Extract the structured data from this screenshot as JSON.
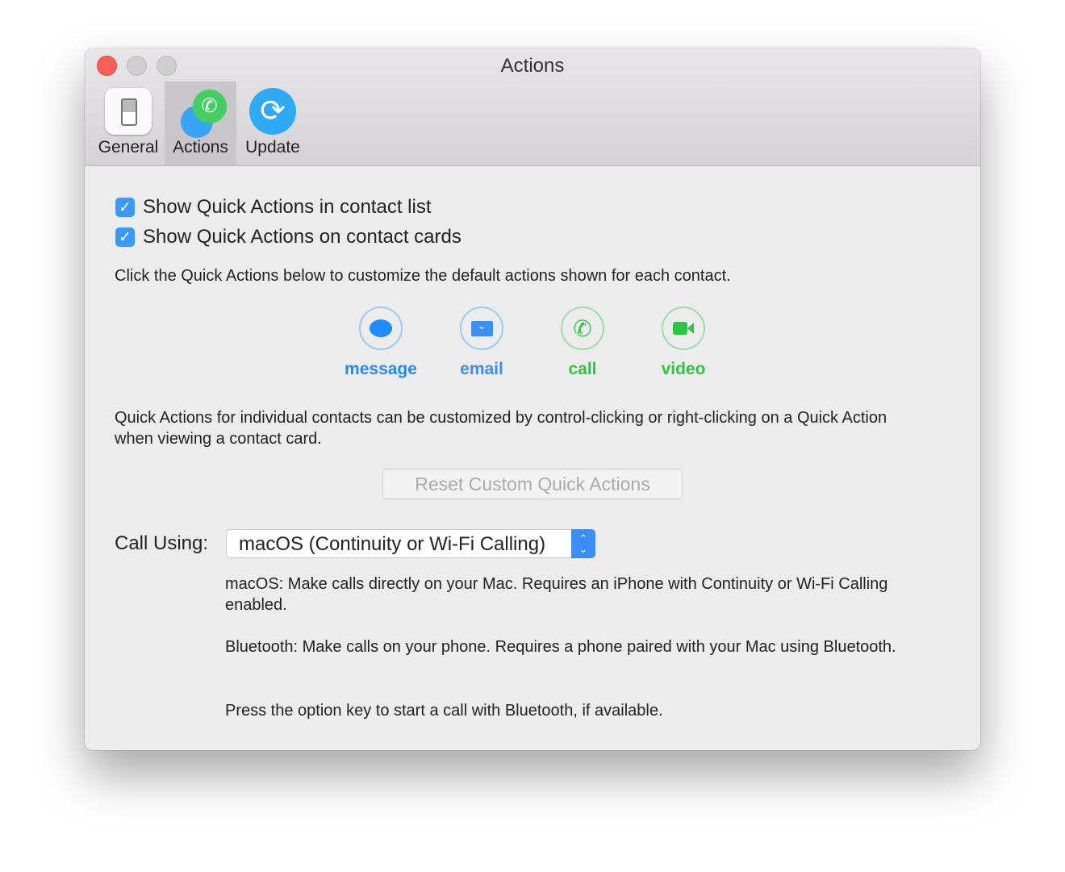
{
  "window": {
    "title": "Actions"
  },
  "toolbar": {
    "tabs": [
      {
        "label": "General",
        "icon": "switch-icon"
      },
      {
        "label": "Actions",
        "icon": "actions-icon",
        "selected": true
      },
      {
        "label": "Update",
        "icon": "refresh-icon"
      }
    ]
  },
  "options": {
    "show_in_list": {
      "label": "Show Quick Actions in contact list",
      "checked": true
    },
    "show_on_cards": {
      "label": "Show Quick Actions on contact cards",
      "checked": true
    }
  },
  "instructions": "Click the Quick Actions below to customize the default actions shown for each contact.",
  "quick_actions": [
    {
      "label": "message",
      "color": "#1e8cff"
    },
    {
      "label": "email",
      "color": "#3b8ef5"
    },
    {
      "label": "call",
      "color": "#2ac840"
    },
    {
      "label": "video",
      "color": "#2ac840"
    }
  ],
  "note": "Quick Actions for individual contacts can be customized by control-clicking or right-clicking on a Quick Action when viewing a contact card.",
  "reset_label": "Reset Custom Quick Actions",
  "call_using": {
    "label": "Call Using:",
    "value": "macOS (Continuity or Wi-Fi Calling)"
  },
  "descriptions": {
    "macos": "macOS: Make calls directly on your Mac. Requires an iPhone with Continuity or Wi-Fi Calling enabled.",
    "bluetooth": "Bluetooth: Make calls on your phone. Requires a phone paired with your Mac using Bluetooth.",
    "option": "Press the option key to start a call with Bluetooth, if available."
  }
}
